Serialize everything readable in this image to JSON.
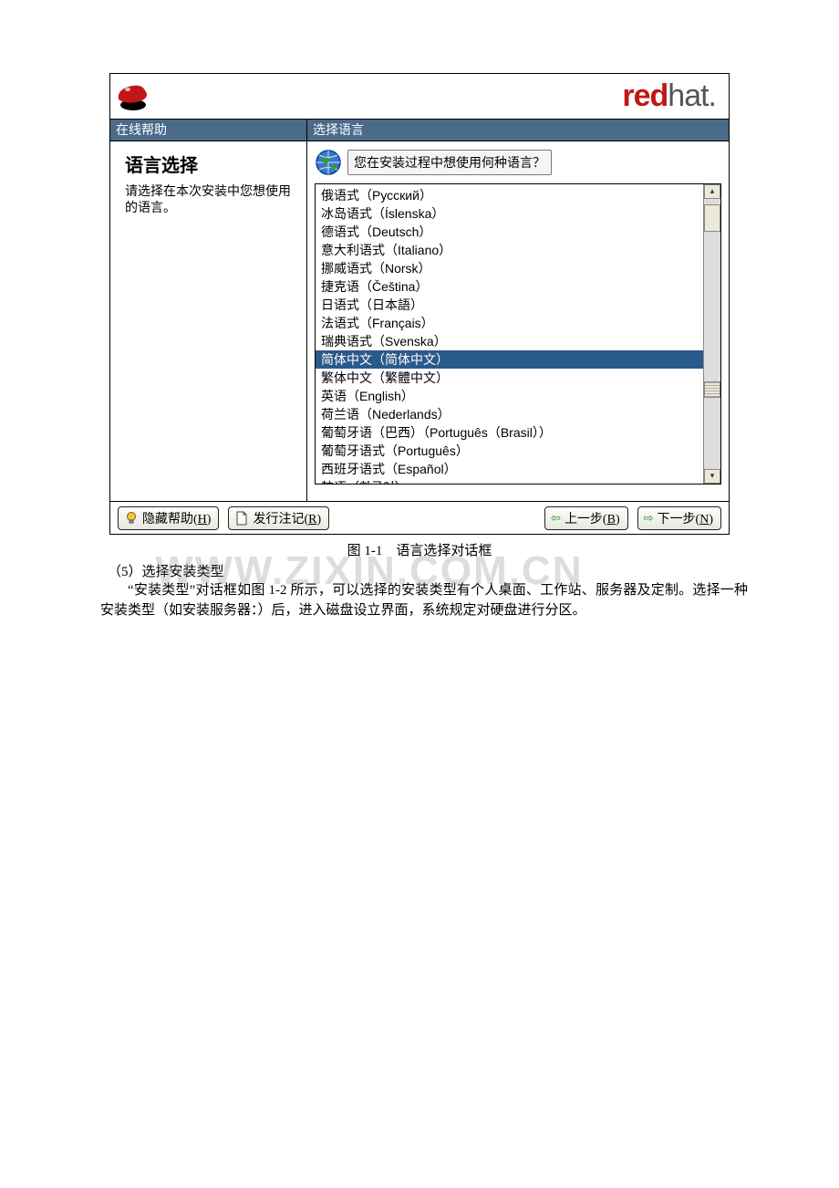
{
  "brand": {
    "red": "red",
    "hat": "hat."
  },
  "left": {
    "header": "在线帮助",
    "title": "语言选择",
    "sub": "请选择在本次安装中您想使用的语言。"
  },
  "right": {
    "header": "选择语言",
    "prompt": "您在安装过程中想使用何种语言？"
  },
  "languages": [
    {
      "label": "俄语式（Русский）",
      "selected": false
    },
    {
      "label": "冰岛语式（Íslenska）",
      "selected": false
    },
    {
      "label": "德语式（Deutsch）",
      "selected": false
    },
    {
      "label": "意大利语式（Italiano）",
      "selected": false
    },
    {
      "label": "挪威语式（Norsk）",
      "selected": false
    },
    {
      "label": "捷克语（Čeština）",
      "selected": false
    },
    {
      "label": "日语式（日本語）",
      "selected": false
    },
    {
      "label": "法语式（Français）",
      "selected": false
    },
    {
      "label": "瑞典语式（Svenska）",
      "selected": false
    },
    {
      "label": "简体中文（简体中文）",
      "selected": true
    },
    {
      "label": "繁体中文（繁體中文）",
      "selected": false
    },
    {
      "label": "英语（English）",
      "selected": false
    },
    {
      "label": "荷兰语（Nederlands）",
      "selected": false
    },
    {
      "label": "葡萄牙语（巴西）（Português（Brasil））",
      "selected": false
    },
    {
      "label": "葡萄牙语式（Português）",
      "selected": false
    },
    {
      "label": "西班牙语式（Español）",
      "selected": false
    },
    {
      "label": "韩语（한국어）",
      "selected": false
    }
  ],
  "buttons": {
    "hide_help_pre": "隐藏帮助(",
    "hide_help_u": "H",
    "hide_help_post": ")",
    "relnotes_pre": "发行注记(",
    "relnotes_u": "R",
    "relnotes_post": ")",
    "back_pre": "上一步(",
    "back_u": "B",
    "back_post": ")",
    "next_pre": "下一步(",
    "next_u": "N",
    "next_post": ")"
  },
  "caption": "图 1-1　语言选择对话框",
  "section5_heading": "（5）选择安装类型",
  "section5_body": "“安装类型”对话框如图 1-2 所示，可以选择的安装类型有个人桌面、工作站、服务器及定制。选择一种安装类型（如安装服务器：）后，进入磁盘设立界面，系统规定对硬盘进行分区。",
  "watermark": "WWW.ZIXIN.COM.CN"
}
